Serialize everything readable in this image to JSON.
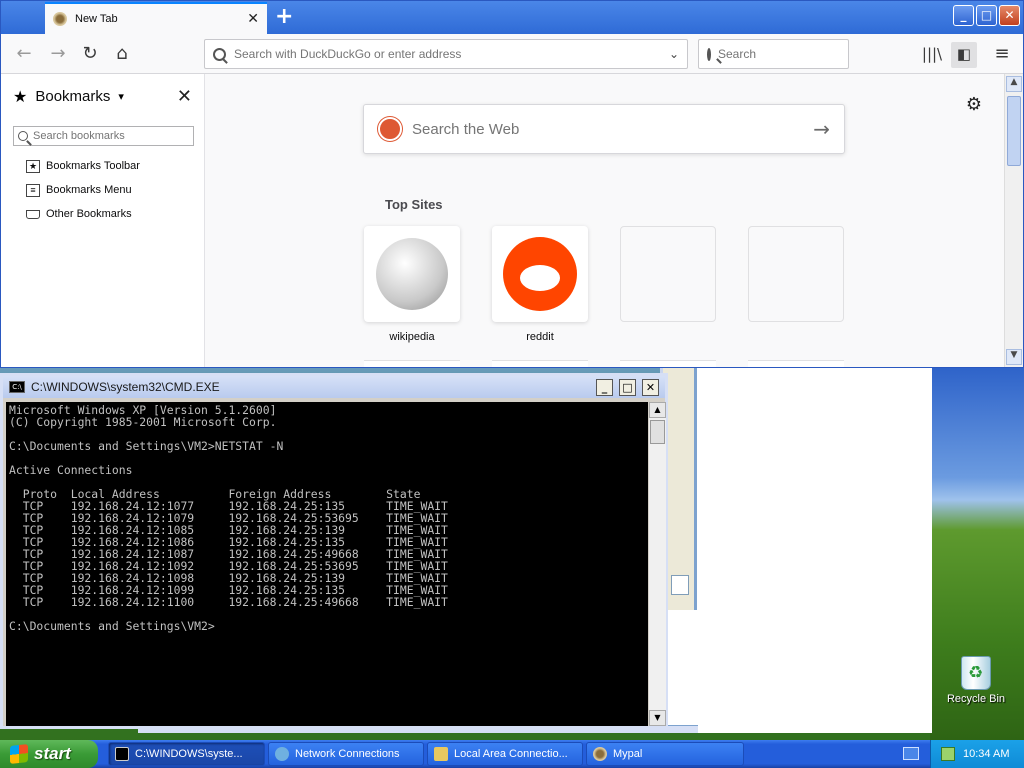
{
  "firefox": {
    "tab_title": "New Tab",
    "url_placeholder": "Search with DuckDuckGo or enter address",
    "search_placeholder": "Search",
    "sidebar": {
      "title": "Bookmarks",
      "search_placeholder": "Search bookmarks",
      "items": [
        {
          "label": "Bookmarks Toolbar",
          "icon": "bookmark-star-icon"
        },
        {
          "label": "Bookmarks Menu",
          "icon": "menu-list-icon"
        },
        {
          "label": "Other Bookmarks",
          "icon": "tray-icon"
        }
      ]
    },
    "newtab": {
      "web_search_placeholder": "Search the Web",
      "top_sites_heading": "Top Sites",
      "top_sites": [
        {
          "label": "wikipedia"
        },
        {
          "label": "reddit"
        },
        {
          "label": ""
        },
        {
          "label": ""
        }
      ]
    }
  },
  "cmd": {
    "title": "C:\\WINDOWS\\system32\\CMD.EXE",
    "output": "Microsoft Windows XP [Version 5.1.2600]\n(C) Copyright 1985-2001 Microsoft Corp.\n\nC:\\Documents and Settings\\VM2>NETSTAT -N\n\nActive Connections\n\n  Proto  Local Address          Foreign Address        State\n  TCP    192.168.24.12:1077     192.168.24.25:135      TIME_WAIT\n  TCP    192.168.24.12:1079     192.168.24.25:53695    TIME_WAIT\n  TCP    192.168.24.12:1085     192.168.24.25:139      TIME_WAIT\n  TCP    192.168.24.12:1086     192.168.24.25:135      TIME_WAIT\n  TCP    192.168.24.12:1087     192.168.24.25:49668    TIME_WAIT\n  TCP    192.168.24.12:1092     192.168.24.25:53695    TIME_WAIT\n  TCP    192.168.24.12:1098     192.168.24.25:139      TIME_WAIT\n  TCP    192.168.24.12:1099     192.168.24.25:135      TIME_WAIT\n  TCP    192.168.24.12:1100     192.168.24.25:49668    TIME_WAIT\n\nC:\\Documents and Settings\\VM2>"
  },
  "desktop": {
    "recycle_bin_label": "Recycle Bin"
  },
  "taskbar": {
    "start_label": "start",
    "tasks": [
      {
        "label": "C:\\WINDOWS\\syste...",
        "icon": "cmd-icon",
        "active": true
      },
      {
        "label": "Network Connections",
        "icon": "network-icon",
        "active": false
      },
      {
        "label": "Local Area Connectio...",
        "icon": "connection-icon",
        "active": false
      },
      {
        "label": "Mypal",
        "icon": "mypal-icon",
        "active": false
      }
    ],
    "clock": "10:34 AM"
  },
  "colors": {
    "firefox_accent": "#0a84ff",
    "reddit": "#ff4500",
    "duckduckgo": "#de5833",
    "xp_blue": "#245edb",
    "start_green": "#3a9b36"
  }
}
